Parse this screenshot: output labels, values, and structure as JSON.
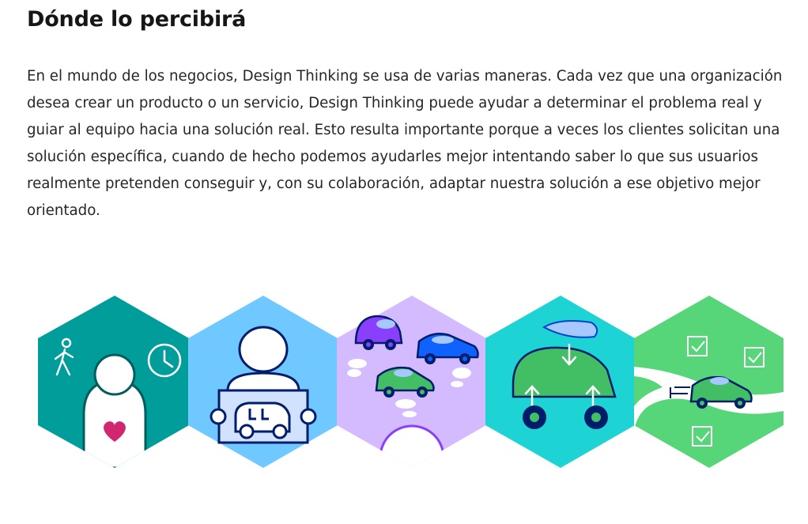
{
  "section": {
    "title": "Dónde lo percibirá",
    "paragraph": "En el mundo de los negocios, Design Thinking se usa de varias maneras. Cada vez que una organización desea crear un producto o un servicio, Design Thinking puede ayudar a determinar el problema real y guiar al equipo hacia una solución real. Esto resulta importante porque a veces los clientes solicitan una solución específica, cuando de hecho podemos ayudarles mejor intentando saber lo que sus usuarios realmente pretenden conseguir y, con su colaboración, adaptar nuestra solución a ese objetivo mejor orientado."
  },
  "illustration": {
    "hexagons": [
      {
        "id": "user-needs",
        "color": "#009d9a",
        "icons": [
          "walking-person-icon",
          "clock-icon",
          "person-icon",
          "heart-icon"
        ]
      },
      {
        "id": "user-request",
        "color": "#6fc8ff",
        "icons": [
          "person-icon",
          "car-sign-icon"
        ]
      },
      {
        "id": "ideas",
        "color": "#d4bbff",
        "icons": [
          "purple-car-icon",
          "blue-car-icon",
          "green-car-icon",
          "thought-bubble-icon"
        ]
      },
      {
        "id": "prototype",
        "color": "#1ed3d3",
        "icons": [
          "car-body-icon",
          "wheel-icon",
          "arrow-icon",
          "windshield-icon"
        ]
      },
      {
        "id": "delivery",
        "color": "#56d679",
        "icons": [
          "checkbox-icon",
          "road-icon",
          "green-car-icon"
        ]
      }
    ],
    "colors": {
      "teal": "#009d9a",
      "sky": "#6fc8ff",
      "lavender": "#d4bbff",
      "cyan": "#1ed3d3",
      "green": "#56d679",
      "navy": "#001d6c",
      "heart": "#d12771"
    }
  }
}
